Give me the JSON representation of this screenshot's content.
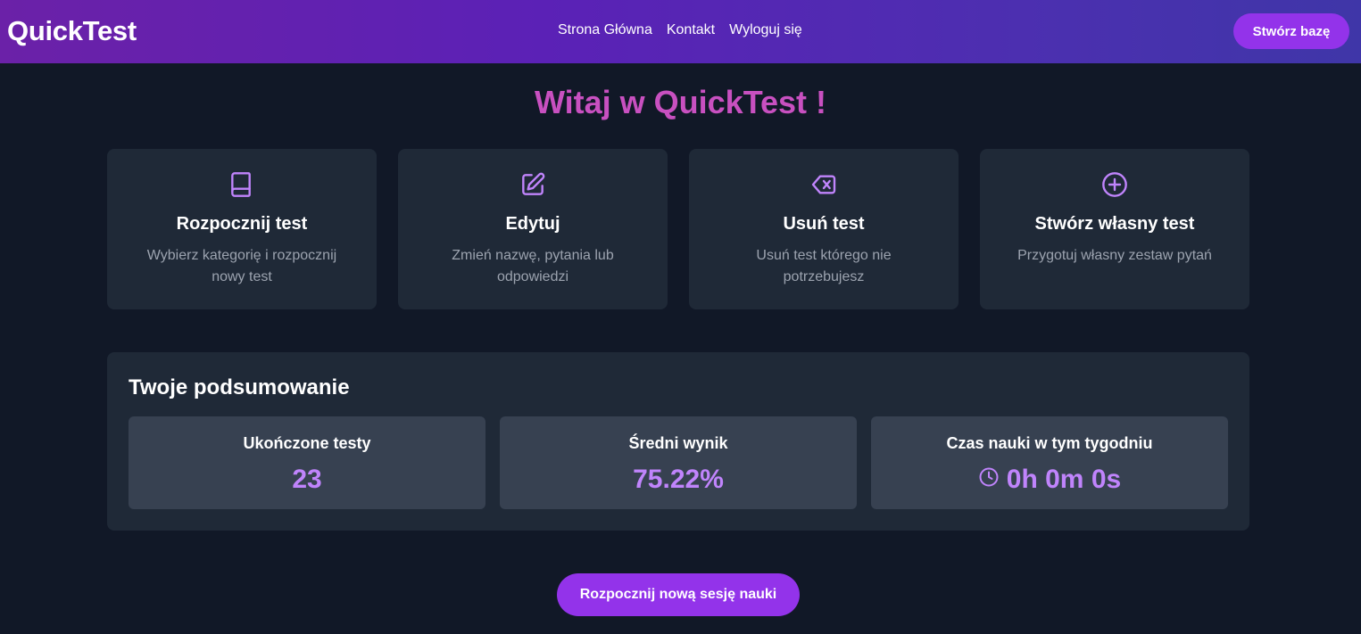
{
  "header": {
    "logo": "QuickTest",
    "nav": [
      "Strona Główna",
      "Kontakt",
      "Wyloguj się"
    ],
    "create_db_label": "Stwórz bazę"
  },
  "welcome": "Witaj w QuickTest !",
  "cards": [
    {
      "icon": "book-icon",
      "title": "Rozpocznij test",
      "desc": "Wybierz kategorię i rozpocznij nowy test"
    },
    {
      "icon": "edit-icon",
      "title": "Edytuj",
      "desc": "Zmień nazwę, pytania lub odpowiedzi"
    },
    {
      "icon": "backspace-delete-icon",
      "title": "Usuń test",
      "desc": "Usuń test którego nie potrzebujesz"
    },
    {
      "icon": "plus-circle-icon",
      "title": "Stwórz własny test",
      "desc": "Przygotuj własny zestaw pytań"
    }
  ],
  "summary": {
    "title": "Twoje podsumowanie",
    "stats": [
      {
        "label": "Ukończone testy",
        "value": "23"
      },
      {
        "label": "Średni wynik",
        "value": "75.22%"
      },
      {
        "label": "Czas nauki w tym tygodniu",
        "value": "0h 0m 0s",
        "icon": "clock-icon"
      }
    ]
  },
  "session_button": "Rozpocznij nową sesję nauki",
  "colors": {
    "background": "#111827",
    "card": "#1f2937",
    "stat": "#374151",
    "accent": "#9333ea",
    "accent_text": "#c084fc",
    "heading": "#c850c0"
  }
}
